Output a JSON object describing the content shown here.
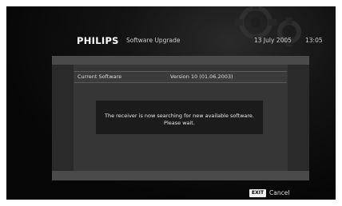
{
  "header": {
    "brand": "PHILIPS",
    "title": "Software Upgrade",
    "date": "13 July 2005",
    "time": "13:05"
  },
  "info": {
    "label": "Current Software",
    "value": "Version 10 (01.06.2003)"
  },
  "message": {
    "line1": "The receiver is now searching for new available software.",
    "line2": "Please wait."
  },
  "footer": {
    "key_label": "EXIT",
    "action_label": "Cancel"
  },
  "icons": {
    "background": "gear-decoration-icon"
  },
  "colors": {
    "background": "#0a0a0a",
    "panel": "#363636",
    "bar": "#4a4a4a",
    "message_box": "#1b1b1b",
    "text": "#dddddd"
  }
}
